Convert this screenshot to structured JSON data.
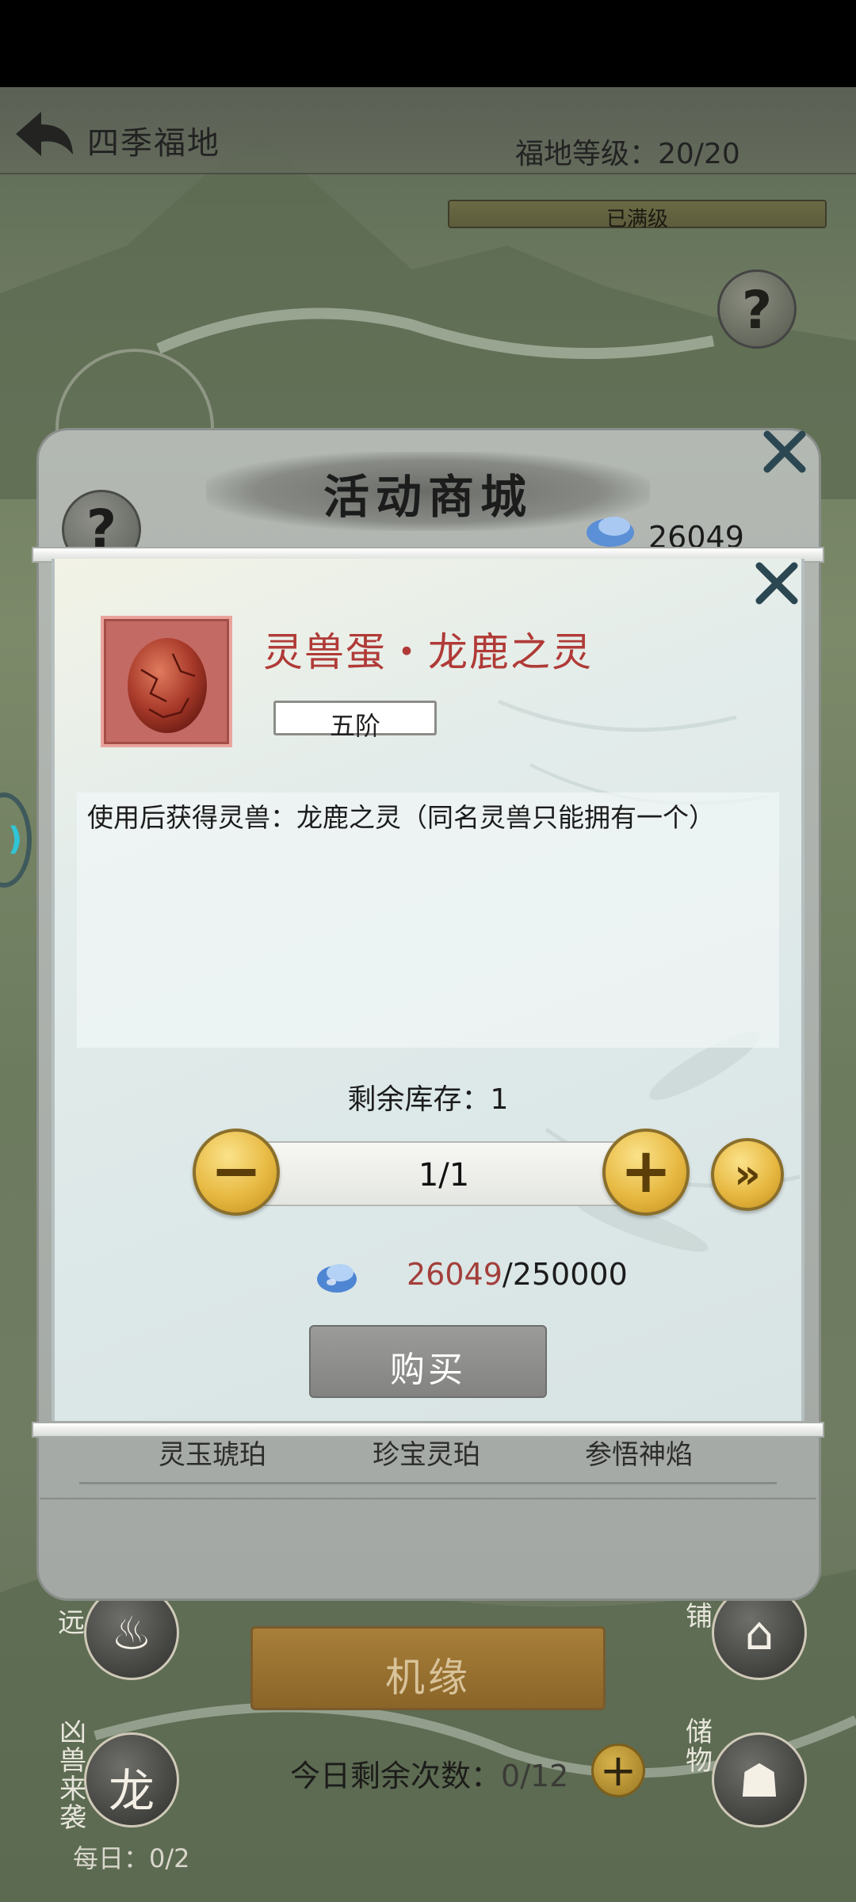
{
  "top_bar": {
    "title": "四季福地",
    "land_level": "福地等级：20/20",
    "level_status": "已满级"
  },
  "shop": {
    "title": "活动商城",
    "currency_amount": "26049",
    "items": [
      "灵玉琥珀",
      "珍宝灵珀",
      "参悟神焰"
    ]
  },
  "item_popup": {
    "name": "灵兽蛋・龙鹿之灵",
    "grade": "五阶",
    "description": "使用后获得灵兽：龙鹿之灵（同名灵兽只能拥有一个）",
    "stock": "剩余库存：1",
    "quantity": "1/1",
    "cost_owned": "26049",
    "cost_required": "/250000",
    "buy_label": "购买",
    "minus_symbol": "−",
    "plus_symbol": "+",
    "max_symbol": "»"
  },
  "background": {
    "side_label_far": "远",
    "side_label_shop": "铺",
    "side_label_beast": "凶兽来袭",
    "side_label_storage": "储物",
    "fate_label": "机缘",
    "today_remain_label": "今日剩余次数：",
    "today_remain_count": "0/12",
    "daily_count": "每日：0/2",
    "help_symbol": "?"
  },
  "colors": {
    "item_name": "#b03a37",
    "owned_cost": "#a33f3b",
    "gold_button": "#e7b942"
  }
}
